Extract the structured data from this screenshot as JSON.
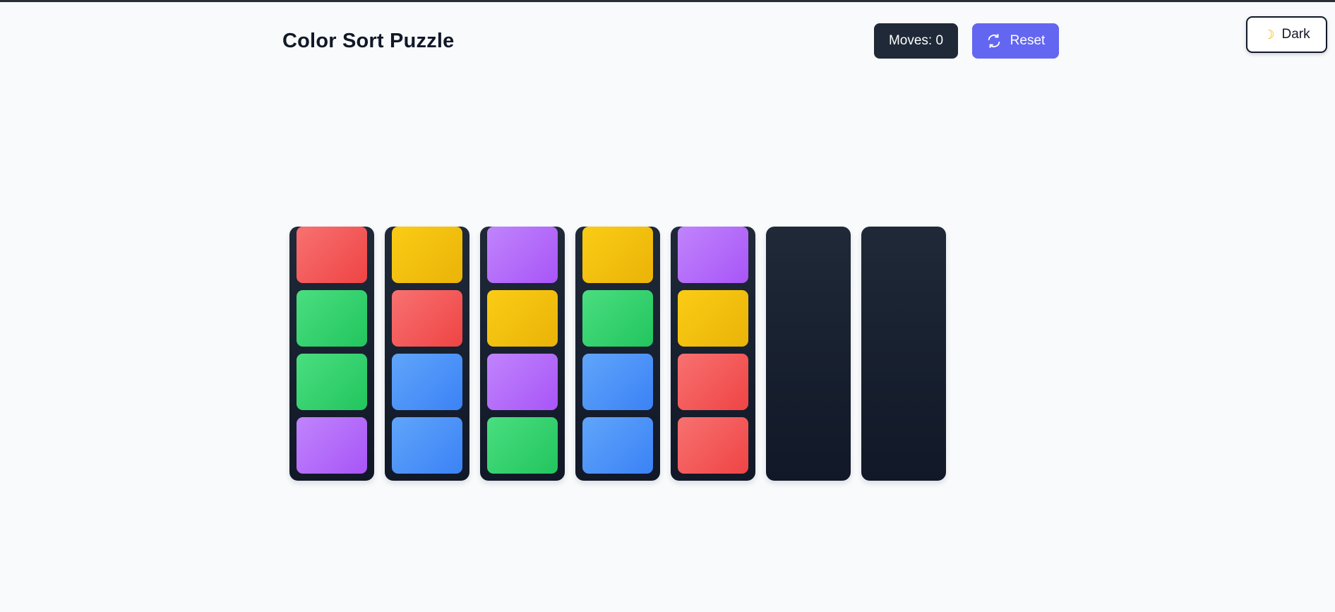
{
  "header": {
    "title": "Color Sort Puzzle",
    "moves_label": "Moves: 0",
    "reset_label": "Reset",
    "reset_icon": "refresh-icon"
  },
  "theme_toggle": {
    "label": "Dark",
    "icon": "moon-icon"
  },
  "colors": {
    "red": "#ef4444",
    "yellow": "#eab308",
    "purple": "#a855f7",
    "green": "#22c55e",
    "blue": "#3b82f6",
    "tube": "#1f2937",
    "reset_button": "#6366f1",
    "moves_badge": "#1f2937"
  },
  "tubes": [
    {
      "balls": [
        "red",
        "green",
        "green",
        "purple"
      ]
    },
    {
      "balls": [
        "yellow",
        "red",
        "blue",
        "blue"
      ]
    },
    {
      "balls": [
        "purple",
        "yellow",
        "purple",
        "green"
      ]
    },
    {
      "balls": [
        "yellow",
        "green",
        "blue",
        "blue"
      ]
    },
    {
      "balls": [
        "purple",
        "yellow",
        "red",
        "red"
      ]
    },
    {
      "balls": []
    },
    {
      "balls": []
    }
  ]
}
